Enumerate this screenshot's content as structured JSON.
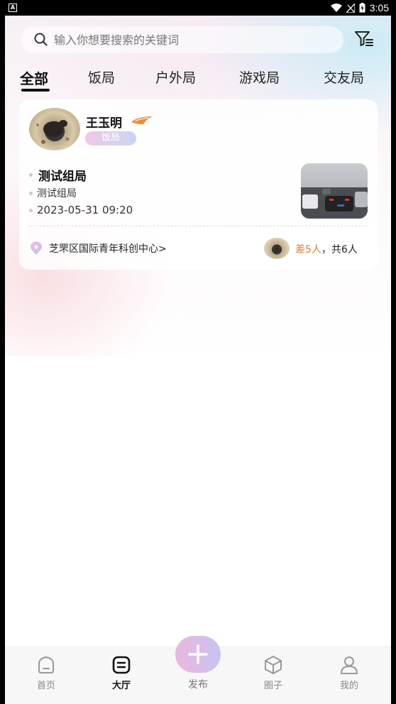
{
  "status_bar": {
    "time": "3:05"
  },
  "search": {
    "placeholder": "输入你想要搜索的关键词"
  },
  "tabs": [
    {
      "label": "全部",
      "active": true
    },
    {
      "label": "饭局"
    },
    {
      "label": "户外局"
    },
    {
      "label": "游戏局"
    },
    {
      "label": "交友局"
    }
  ],
  "card": {
    "username": "王玉明",
    "tag": "饭局",
    "title": "测试组局",
    "description": "测试组局",
    "datetime": "2023-05-31 09:20",
    "location": "芝罘区国际青年科创中心",
    "location_arrow": ">",
    "missing": "差5人",
    "separator": "，",
    "total": "共6人"
  },
  "bottom_nav": {
    "home": "首页",
    "hall": "大厅",
    "publish": "发布",
    "circle": "圈子",
    "mine": "我的"
  },
  "colors": {
    "accent_orange": "#e07b39",
    "tag_gradient_start": "#efc8e6",
    "tag_gradient_end": "#c8d6f3",
    "publish_gradient_start": "#e9b7de",
    "publish_gradient_end": "#c9c3f0"
  }
}
